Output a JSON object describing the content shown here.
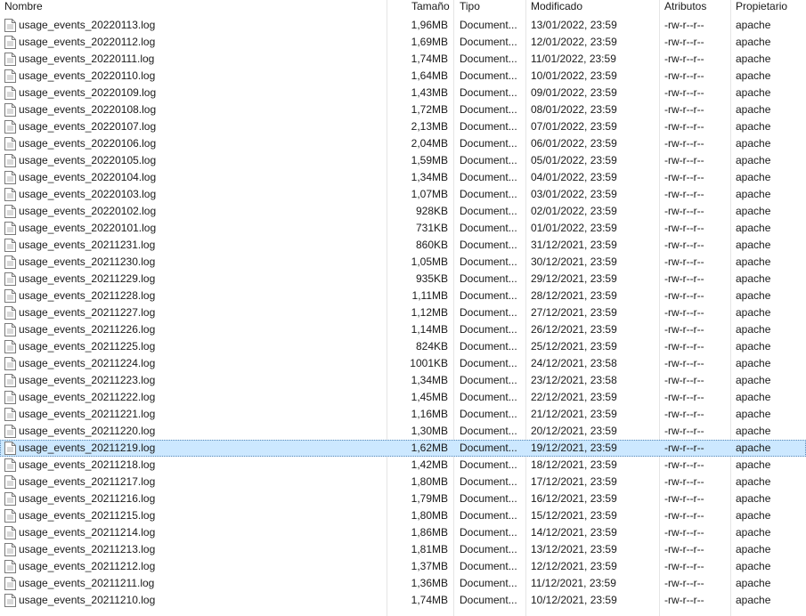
{
  "columns": {
    "name": "Nombre",
    "size": "Tamaño",
    "type": "Tipo",
    "modified": "Modificado",
    "attributes": "Atributos",
    "owner": "Propietario"
  },
  "selected_index": 25,
  "icon": "document-file-icon",
  "files": [
    {
      "name": "usage_events_20220113.log",
      "size": "1,96MB",
      "type": "Document...",
      "modified": "13/01/2022, 23:59",
      "attributes": "-rw-r--r--",
      "owner": "apache"
    },
    {
      "name": "usage_events_20220112.log",
      "size": "1,69MB",
      "type": "Document...",
      "modified": "12/01/2022, 23:59",
      "attributes": "-rw-r--r--",
      "owner": "apache"
    },
    {
      "name": "usage_events_20220111.log",
      "size": "1,74MB",
      "type": "Document...",
      "modified": "11/01/2022, 23:59",
      "attributes": "-rw-r--r--",
      "owner": "apache"
    },
    {
      "name": "usage_events_20220110.log",
      "size": "1,64MB",
      "type": "Document...",
      "modified": "10/01/2022, 23:59",
      "attributes": "-rw-r--r--",
      "owner": "apache"
    },
    {
      "name": "usage_events_20220109.log",
      "size": "1,43MB",
      "type": "Document...",
      "modified": "09/01/2022, 23:59",
      "attributes": "-rw-r--r--",
      "owner": "apache"
    },
    {
      "name": "usage_events_20220108.log",
      "size": "1,72MB",
      "type": "Document...",
      "modified": "08/01/2022, 23:59",
      "attributes": "-rw-r--r--",
      "owner": "apache"
    },
    {
      "name": "usage_events_20220107.log",
      "size": "2,13MB",
      "type": "Document...",
      "modified": "07/01/2022, 23:59",
      "attributes": "-rw-r--r--",
      "owner": "apache"
    },
    {
      "name": "usage_events_20220106.log",
      "size": "2,04MB",
      "type": "Document...",
      "modified": "06/01/2022, 23:59",
      "attributes": "-rw-r--r--",
      "owner": "apache"
    },
    {
      "name": "usage_events_20220105.log",
      "size": "1,59MB",
      "type": "Document...",
      "modified": "05/01/2022, 23:59",
      "attributes": "-rw-r--r--",
      "owner": "apache"
    },
    {
      "name": "usage_events_20220104.log",
      "size": "1,34MB",
      "type": "Document...",
      "modified": "04/01/2022, 23:59",
      "attributes": "-rw-r--r--",
      "owner": "apache"
    },
    {
      "name": "usage_events_20220103.log",
      "size": "1,07MB",
      "type": "Document...",
      "modified": "03/01/2022, 23:59",
      "attributes": "-rw-r--r--",
      "owner": "apache"
    },
    {
      "name": "usage_events_20220102.log",
      "size": "928KB",
      "type": "Document...",
      "modified": "02/01/2022, 23:59",
      "attributes": "-rw-r--r--",
      "owner": "apache"
    },
    {
      "name": "usage_events_20220101.log",
      "size": "731KB",
      "type": "Document...",
      "modified": "01/01/2022, 23:59",
      "attributes": "-rw-r--r--",
      "owner": "apache"
    },
    {
      "name": "usage_events_20211231.log",
      "size": "860KB",
      "type": "Document...",
      "modified": "31/12/2021, 23:59",
      "attributes": "-rw-r--r--",
      "owner": "apache"
    },
    {
      "name": "usage_events_20211230.log",
      "size": "1,05MB",
      "type": "Document...",
      "modified": "30/12/2021, 23:59",
      "attributes": "-rw-r--r--",
      "owner": "apache"
    },
    {
      "name": "usage_events_20211229.log",
      "size": "935KB",
      "type": "Document...",
      "modified": "29/12/2021, 23:59",
      "attributes": "-rw-r--r--",
      "owner": "apache"
    },
    {
      "name": "usage_events_20211228.log",
      "size": "1,11MB",
      "type": "Document...",
      "modified": "28/12/2021, 23:59",
      "attributes": "-rw-r--r--",
      "owner": "apache"
    },
    {
      "name": "usage_events_20211227.log",
      "size": "1,12MB",
      "type": "Document...",
      "modified": "27/12/2021, 23:59",
      "attributes": "-rw-r--r--",
      "owner": "apache"
    },
    {
      "name": "usage_events_20211226.log",
      "size": "1,14MB",
      "type": "Document...",
      "modified": "26/12/2021, 23:59",
      "attributes": "-rw-r--r--",
      "owner": "apache"
    },
    {
      "name": "usage_events_20211225.log",
      "size": "824KB",
      "type": "Document...",
      "modified": "25/12/2021, 23:59",
      "attributes": "-rw-r--r--",
      "owner": "apache"
    },
    {
      "name": "usage_events_20211224.log",
      "size": "1001KB",
      "type": "Document...",
      "modified": "24/12/2021, 23:58",
      "attributes": "-rw-r--r--",
      "owner": "apache"
    },
    {
      "name": "usage_events_20211223.log",
      "size": "1,34MB",
      "type": "Document...",
      "modified": "23/12/2021, 23:58",
      "attributes": "-rw-r--r--",
      "owner": "apache"
    },
    {
      "name": "usage_events_20211222.log",
      "size": "1,45MB",
      "type": "Document...",
      "modified": "22/12/2021, 23:59",
      "attributes": "-rw-r--r--",
      "owner": "apache"
    },
    {
      "name": "usage_events_20211221.log",
      "size": "1,16MB",
      "type": "Document...",
      "modified": "21/12/2021, 23:59",
      "attributes": "-rw-r--r--",
      "owner": "apache"
    },
    {
      "name": "usage_events_20211220.log",
      "size": "1,30MB",
      "type": "Document...",
      "modified": "20/12/2021, 23:59",
      "attributes": "-rw-r--r--",
      "owner": "apache"
    },
    {
      "name": "usage_events_20211219.log",
      "size": "1,62MB",
      "type": "Document...",
      "modified": "19/12/2021, 23:59",
      "attributes": "-rw-r--r--",
      "owner": "apache"
    },
    {
      "name": "usage_events_20211218.log",
      "size": "1,42MB",
      "type": "Document...",
      "modified": "18/12/2021, 23:59",
      "attributes": "-rw-r--r--",
      "owner": "apache"
    },
    {
      "name": "usage_events_20211217.log",
      "size": "1,80MB",
      "type": "Document...",
      "modified": "17/12/2021, 23:59",
      "attributes": "-rw-r--r--",
      "owner": "apache"
    },
    {
      "name": "usage_events_20211216.log",
      "size": "1,79MB",
      "type": "Document...",
      "modified": "16/12/2021, 23:59",
      "attributes": "-rw-r--r--",
      "owner": "apache"
    },
    {
      "name": "usage_events_20211215.log",
      "size": "1,80MB",
      "type": "Document...",
      "modified": "15/12/2021, 23:59",
      "attributes": "-rw-r--r--",
      "owner": "apache"
    },
    {
      "name": "usage_events_20211214.log",
      "size": "1,86MB",
      "type": "Document...",
      "modified": "14/12/2021, 23:59",
      "attributes": "-rw-r--r--",
      "owner": "apache"
    },
    {
      "name": "usage_events_20211213.log",
      "size": "1,81MB",
      "type": "Document...",
      "modified": "13/12/2021, 23:59",
      "attributes": "-rw-r--r--",
      "owner": "apache"
    },
    {
      "name": "usage_events_20211212.log",
      "size": "1,37MB",
      "type": "Document...",
      "modified": "12/12/2021, 23:59",
      "attributes": "-rw-r--r--",
      "owner": "apache"
    },
    {
      "name": "usage_events_20211211.log",
      "size": "1,36MB",
      "type": "Document...",
      "modified": "11/12/2021, 23:59",
      "attributes": "-rw-r--r--",
      "owner": "apache"
    },
    {
      "name": "usage_events_20211210.log",
      "size": "1,74MB",
      "type": "Document...",
      "modified": "10/12/2021, 23:59",
      "attributes": "-rw-r--r--",
      "owner": "apache"
    }
  ]
}
